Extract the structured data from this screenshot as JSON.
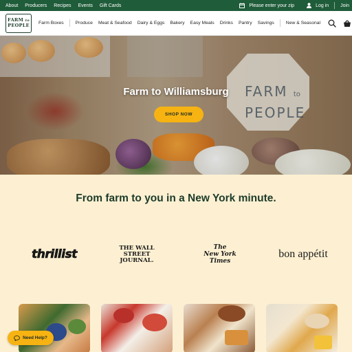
{
  "topbar": {
    "links": [
      "About",
      "Producers",
      "Recipes",
      "Events",
      "Gift Cards"
    ],
    "zip_prompt": "Please enter your zip",
    "login": "Log in",
    "join": "Join"
  },
  "nav": {
    "logo_line1": "FARM",
    "logo_to": "to",
    "logo_line2": "PEOPLE",
    "farm_boxes": "Farm Boxes",
    "categories": [
      "Produce",
      "Meat & Seafood",
      "Dairy & Eggs",
      "Bakery",
      "Easy Meals",
      "Drinks",
      "Pantry",
      "Savings"
    ],
    "new_seasonal": "New & Seasonal"
  },
  "hero": {
    "title": "Farm to Williamsburg",
    "cta": "SHOP NOW",
    "box_line1": "FARM",
    "box_to": "to",
    "box_line2": "PEOPLE"
  },
  "tagline": "From farm to you in a New York minute.",
  "press": {
    "thrillist": "thrillist",
    "wsj_line1": "THE WALL STREET",
    "wsj_line2": "JOURNAL.",
    "nyt_line1": "The",
    "nyt_line2": "New York",
    "nyt_line3": "Times",
    "bon_appetit": "bon appétit"
  },
  "help": {
    "label": "Need Help?"
  },
  "colors": {
    "brand_green": "#1f5c3a",
    "accent_yellow": "#f6b312",
    "cream_bg": "#fdf0d2",
    "dark_green_text": "#1c3b2a"
  }
}
